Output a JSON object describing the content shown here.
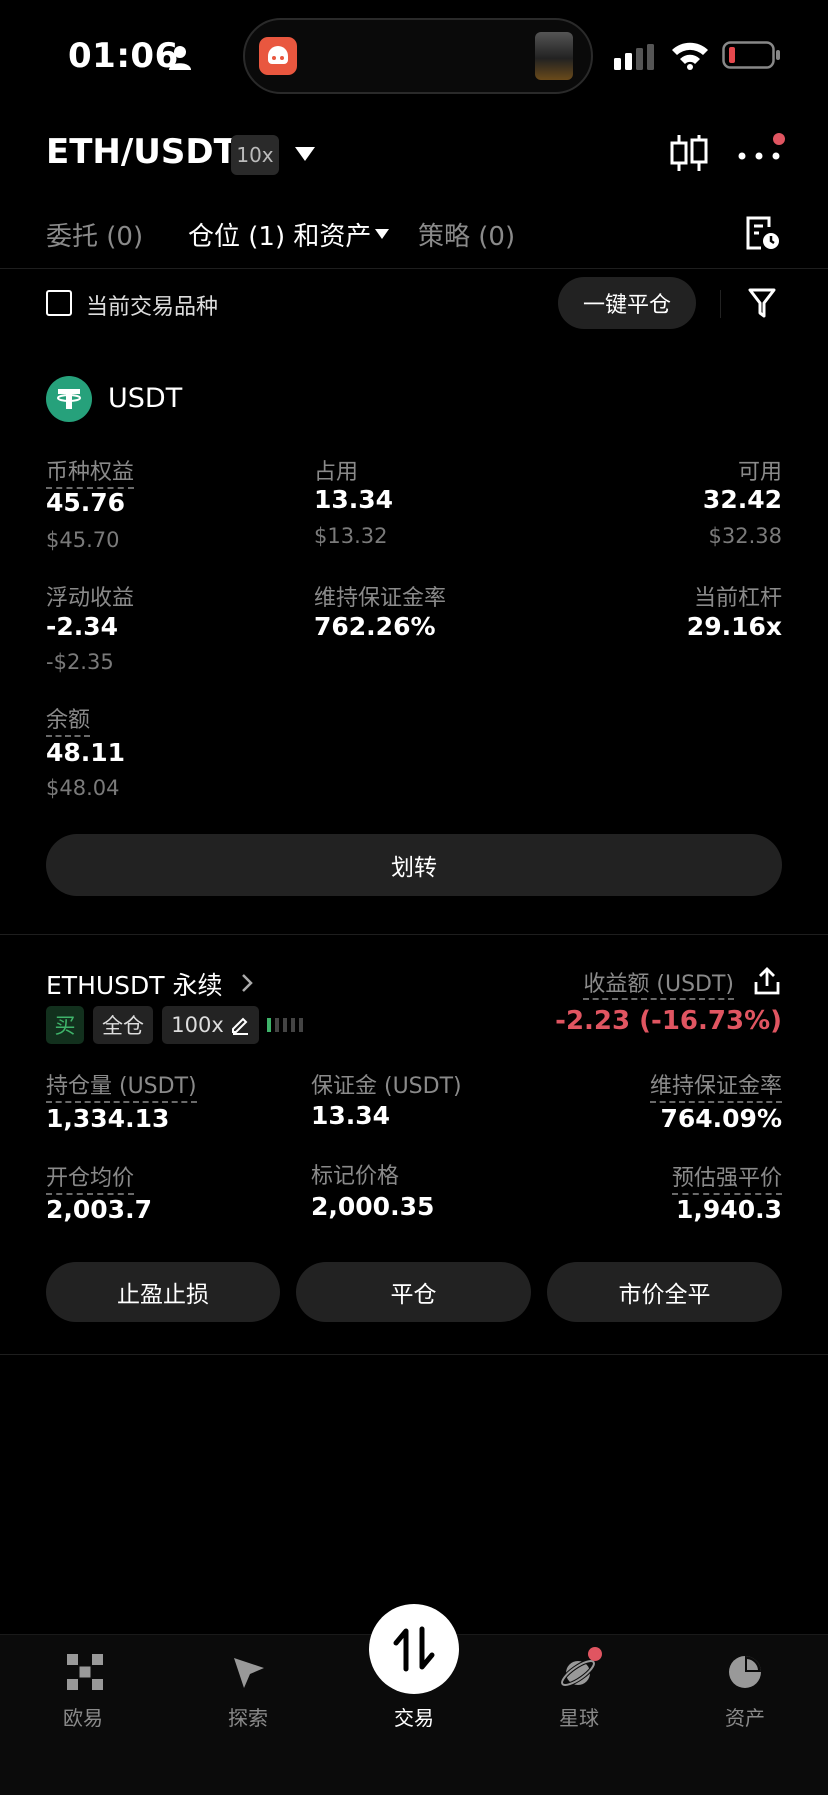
{
  "status": {
    "time": "01:06"
  },
  "header": {
    "pair": "ETH/USDT",
    "leverage_badge": "10x"
  },
  "tabs": {
    "orders": "委托 (0)",
    "positions": "仓位 (1) 和资产",
    "strategy": "策略 (0)"
  },
  "filter": {
    "checkbox_label": "当前交易品种",
    "close_all": "一键平仓"
  },
  "asset": {
    "currency": "USDT",
    "equity": {
      "label": "币种权益",
      "value": "45.76",
      "usd": "$45.70"
    },
    "occupied": {
      "label": "占用",
      "value": "13.34",
      "usd": "$13.32"
    },
    "available": {
      "label": "可用",
      "value": "32.42",
      "usd": "$32.38"
    },
    "floating_pnl": {
      "label": "浮动收益",
      "value": "-2.34",
      "usd": "-$2.35"
    },
    "maint_margin_rate": {
      "label": "维持保证金率",
      "value": "762.26%"
    },
    "current_leverage": {
      "label": "当前杠杆",
      "value": "29.16x"
    },
    "balance": {
      "label": "余额",
      "value": "48.11",
      "usd": "$48.04"
    },
    "transfer_label": "划转"
  },
  "position": {
    "title": "ETHUSDT 永续",
    "pnl_label": "收益额 (USDT)",
    "pnl_value": "-2.23 (-16.73%)",
    "tags": {
      "side": "买",
      "mode": "全仓",
      "leverage": "100x"
    },
    "size": {
      "label": "持仓量 (USDT)",
      "value": "1,334.13"
    },
    "margin": {
      "label": "保证金 (USDT)",
      "value": "13.34"
    },
    "maint_margin_rate": {
      "label": "维持保证金率",
      "value": "764.09%"
    },
    "avg_entry": {
      "label": "开仓均价",
      "value": "2,003.7"
    },
    "mark_price": {
      "label": "标记价格",
      "value": "2,000.35"
    },
    "liq_price": {
      "label": "预估强平价",
      "value": "1,940.3"
    },
    "actions": {
      "tp_sl": "止盈止损",
      "close": "平仓",
      "market_close": "市价全平"
    }
  },
  "nav": [
    {
      "label": "欧易",
      "icon": "okx-logo-icon"
    },
    {
      "label": "探索",
      "icon": "compass-icon"
    },
    {
      "label": "交易",
      "icon": "trade-swap-icon"
    },
    {
      "label": "星球",
      "icon": "planet-icon"
    },
    {
      "label": "资产",
      "icon": "pie-chart-icon"
    }
  ],
  "colors": {
    "negative": "#e05561",
    "buy": "#3fb46a",
    "usdt": "#26a17b"
  }
}
